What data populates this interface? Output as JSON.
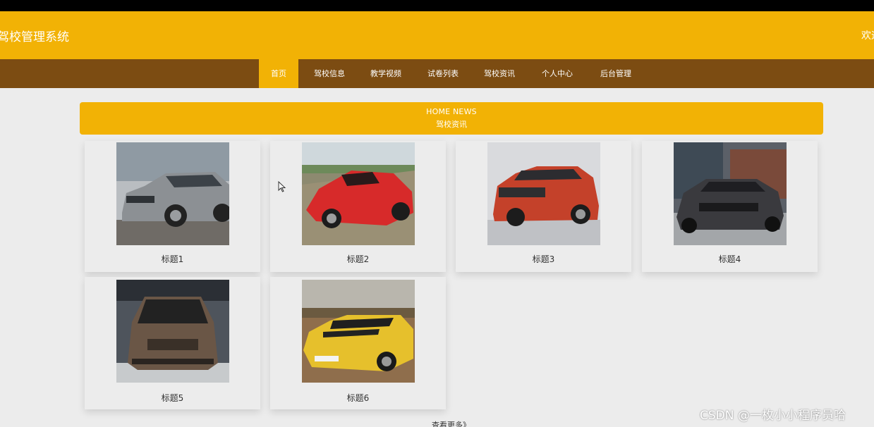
{
  "header": {
    "site_title": "驾校管理系统",
    "welcome": "欢迎"
  },
  "nav": {
    "items": [
      {
        "label": "首页",
        "active": true
      },
      {
        "label": "驾校信息",
        "active": false
      },
      {
        "label": "教学视频",
        "active": false
      },
      {
        "label": "试卷列表",
        "active": false
      },
      {
        "label": "驾校资讯",
        "active": false
      },
      {
        "label": "个人中心",
        "active": false
      },
      {
        "label": "后台管理",
        "active": false
      }
    ]
  },
  "news": {
    "heading_en": "HOME NEWS",
    "heading_cn": "驾校资讯",
    "items": [
      {
        "title": "标题1",
        "image": "silver-suv"
      },
      {
        "title": "标题2",
        "image": "red-sports-car"
      },
      {
        "title": "标题3",
        "image": "red-suv"
      },
      {
        "title": "标题4",
        "image": "black-sedan"
      },
      {
        "title": "标题5",
        "image": "brown-mpv"
      },
      {
        "title": "标题6",
        "image": "yellow-camaro"
      }
    ],
    "more_link": "查看更多》"
  },
  "watermark": "CSDN @一枚小小程序员哈",
  "colors": {
    "brand_yellow": "#f2b205",
    "nav_brown": "#7c4c12",
    "background": "#ececec"
  }
}
